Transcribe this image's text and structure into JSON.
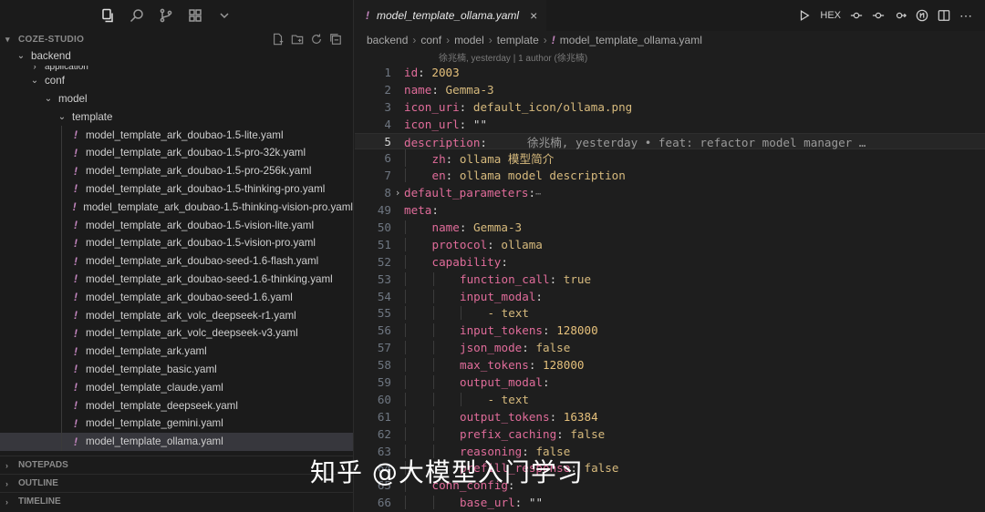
{
  "activity_bar": {
    "icons": [
      "files-icon",
      "search-icon",
      "source-control-icon",
      "extensions-icon",
      "chevron-down-icon"
    ]
  },
  "explorer": {
    "title": "COZE-STUDIO",
    "tree": [
      {
        "label": "backend",
        "level": 0,
        "type": "folder",
        "expanded": true
      },
      {
        "label": "application",
        "level": 1,
        "type": "folder",
        "expanded": false
      },
      {
        "label": "conf",
        "level": 1,
        "type": "folder",
        "expanded": true
      },
      {
        "label": "model",
        "level": 2,
        "type": "folder",
        "expanded": true
      },
      {
        "label": "template",
        "level": 3,
        "type": "folder",
        "expanded": true
      },
      {
        "label": "model_template_ark_doubao-1.5-lite.yaml",
        "level": 4,
        "type": "yaml"
      },
      {
        "label": "model_template_ark_doubao-1.5-pro-32k.yaml",
        "level": 4,
        "type": "yaml"
      },
      {
        "label": "model_template_ark_doubao-1.5-pro-256k.yaml",
        "level": 4,
        "type": "yaml"
      },
      {
        "label": "model_template_ark_doubao-1.5-thinking-pro.yaml",
        "level": 4,
        "type": "yaml"
      },
      {
        "label": "model_template_ark_doubao-1.5-thinking-vision-pro.yaml",
        "level": 4,
        "type": "yaml"
      },
      {
        "label": "model_template_ark_doubao-1.5-vision-lite.yaml",
        "level": 4,
        "type": "yaml"
      },
      {
        "label": "model_template_ark_doubao-1.5-vision-pro.yaml",
        "level": 4,
        "type": "yaml"
      },
      {
        "label": "model_template_ark_doubao-seed-1.6-flash.yaml",
        "level": 4,
        "type": "yaml"
      },
      {
        "label": "model_template_ark_doubao-seed-1.6-thinking.yaml",
        "level": 4,
        "type": "yaml"
      },
      {
        "label": "model_template_ark_doubao-seed-1.6.yaml",
        "level": 4,
        "type": "yaml"
      },
      {
        "label": "model_template_ark_volc_deepseek-r1.yaml",
        "level": 4,
        "type": "yaml"
      },
      {
        "label": "model_template_ark_volc_deepseek-v3.yaml",
        "level": 4,
        "type": "yaml"
      },
      {
        "label": "model_template_ark.yaml",
        "level": 4,
        "type": "yaml"
      },
      {
        "label": "model_template_basic.yaml",
        "level": 4,
        "type": "yaml"
      },
      {
        "label": "model_template_claude.yaml",
        "level": 4,
        "type": "yaml"
      },
      {
        "label": "model_template_deepseek.yaml",
        "level": 4,
        "type": "yaml"
      },
      {
        "label": "model_template_gemini.yaml",
        "level": 4,
        "type": "yaml"
      },
      {
        "label": "model_template_ollama.yaml",
        "level": 4,
        "type": "yaml",
        "selected": true
      }
    ],
    "sections": [
      "NOTEPADS",
      "OUTLINE",
      "TIMELINE"
    ]
  },
  "editor": {
    "tab_label": "model_template_ollama.yaml",
    "actions": [
      "run-icon",
      "HEX",
      "go-back-icon",
      "go-forward-icon",
      "compare-icon",
      "split-editor-icon",
      "more-icon"
    ],
    "breadcrumb": [
      "backend",
      "conf",
      "model",
      "template",
      "model_template_ollama.yaml"
    ],
    "codelens": "徐兆楠, yesterday | 1 author (徐兆楠)",
    "lines": [
      {
        "n": "1",
        "indent": 0,
        "key": "id",
        "val": "2003",
        "vt": "n"
      },
      {
        "n": "2",
        "indent": 0,
        "key": "name",
        "val": "Gemma-3",
        "vt": "v"
      },
      {
        "n": "3",
        "indent": 0,
        "key": "icon_uri",
        "val": "default_icon/ollama.png",
        "vt": "v"
      },
      {
        "n": "4",
        "indent": 0,
        "key": "icon_url",
        "val": "\"\"",
        "vt": "s"
      },
      {
        "n": "5",
        "indent": 0,
        "key": "description",
        "val": "",
        "vt": "v",
        "current": true,
        "blame": "徐兆楠, yesterday • feat: refactor model manager …"
      },
      {
        "n": "6",
        "indent": 1,
        "key": "zh",
        "val": "ollama 模型简介",
        "vt": "v"
      },
      {
        "n": "7",
        "indent": 1,
        "key": "en",
        "val": "ollama model description",
        "vt": "v"
      },
      {
        "n": "8",
        "indent": 0,
        "key": "default_parameters",
        "val": "",
        "vt": "v",
        "folded": true
      },
      {
        "n": "49",
        "indent": 0,
        "key": "meta",
        "val": "",
        "vt": "v"
      },
      {
        "n": "50",
        "indent": 1,
        "key": "name",
        "val": "Gemma-3",
        "vt": "v"
      },
      {
        "n": "51",
        "indent": 1,
        "key": "protocol",
        "val": "ollama",
        "vt": "v"
      },
      {
        "n": "52",
        "indent": 1,
        "key": "capability",
        "val": "",
        "vt": "v"
      },
      {
        "n": "53",
        "indent": 2,
        "key": "function_call",
        "val": "true",
        "vt": "v"
      },
      {
        "n": "54",
        "indent": 2,
        "key": "input_modal",
        "val": "",
        "vt": "v"
      },
      {
        "n": "55",
        "indent": 3,
        "key": "",
        "val": "- text",
        "vt": "v",
        "list": true
      },
      {
        "n": "56",
        "indent": 2,
        "key": "input_tokens",
        "val": "128000",
        "vt": "n"
      },
      {
        "n": "57",
        "indent": 2,
        "key": "json_mode",
        "val": "false",
        "vt": "v"
      },
      {
        "n": "58",
        "indent": 2,
        "key": "max_tokens",
        "val": "128000",
        "vt": "n"
      },
      {
        "n": "59",
        "indent": 2,
        "key": "output_modal",
        "val": "",
        "vt": "v"
      },
      {
        "n": "60",
        "indent": 3,
        "key": "",
        "val": "- text",
        "vt": "v",
        "list": true
      },
      {
        "n": "61",
        "indent": 2,
        "key": "output_tokens",
        "val": "16384",
        "vt": "n"
      },
      {
        "n": "62",
        "indent": 2,
        "key": "prefix_caching",
        "val": "false",
        "vt": "v"
      },
      {
        "n": "63",
        "indent": 2,
        "key": "reasoning",
        "val": "false",
        "vt": "v"
      },
      {
        "n": "64",
        "indent": 2,
        "key": "prefill_response",
        "val": "false",
        "vt": "v"
      },
      {
        "n": "65",
        "indent": 1,
        "key": "conn_config",
        "val": "",
        "vt": "v"
      },
      {
        "n": "66",
        "indent": 2,
        "key": "base_url",
        "val": "\"\"",
        "vt": "s"
      }
    ]
  },
  "watermark": "知乎 @大模型入门学习",
  "colors": {
    "key": "#e06c9a",
    "string": "#d7ba7d",
    "number": "#e5c07b",
    "yaml_icon": "#c586c0",
    "selected_row": "#37373d"
  }
}
